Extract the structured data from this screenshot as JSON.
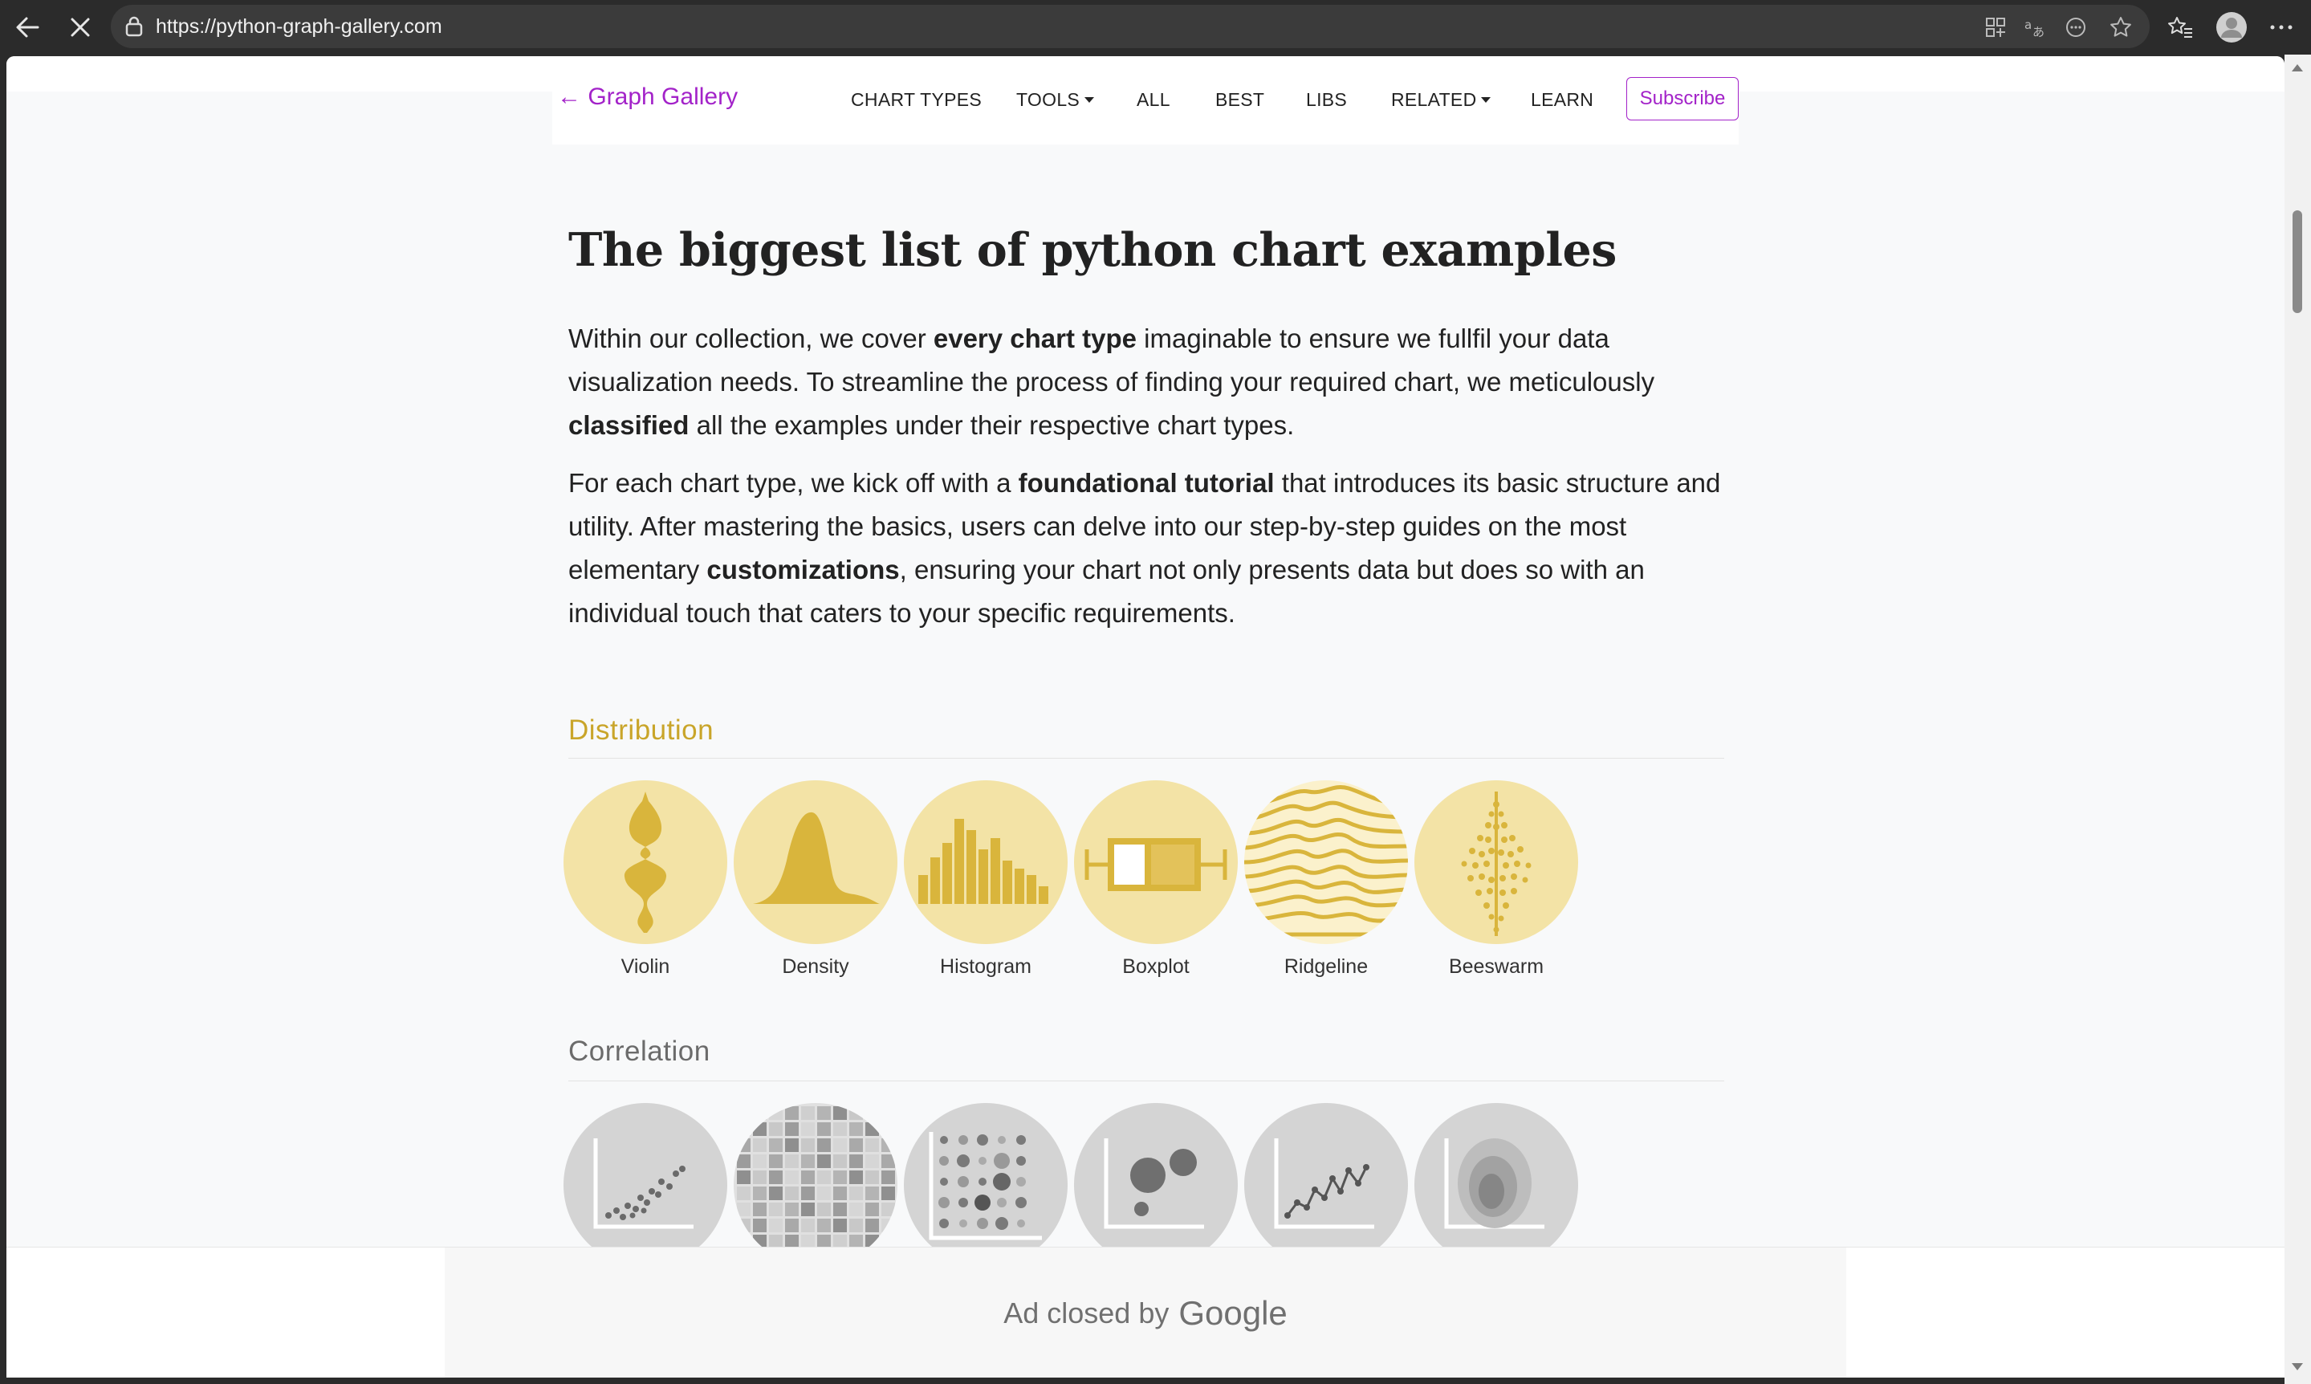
{
  "browser": {
    "url": "https://python-graph-gallery.com",
    "icons": [
      "back-arrow-icon",
      "stop-loading-icon",
      "lock-icon",
      "apps-icon",
      "translate-icon",
      "reading-view-icon",
      "favorite-star-icon",
      "favorites-list-icon",
      "profile-avatar-icon",
      "more-menu-icon"
    ]
  },
  "navbar": {
    "brand": "← Graph Gallery",
    "links": [
      "CHART TYPES",
      "TOOLS",
      "ALL",
      "BEST",
      "LIBS",
      "RELATED",
      "LEARN"
    ],
    "subscribe": "Subscribe",
    "accent_color": "#a323c9"
  },
  "main": {
    "title": "The biggest list of python chart examples",
    "intro": {
      "p1_a": "Within our collection, we cover ",
      "p1_b": "every chart type",
      "p1_c": " imaginable to ensure we fullfil your data visualization needs. To streamline the process of finding your required chart, we meticulously ",
      "p1_d": "classified",
      "p1_e": " all the examples under their respective chart types.",
      "p2_a": "For each chart type, we kick off with a ",
      "p2_b": "foundational tutorial",
      "p2_c": " that introduces its basic structure and utility. After mastering the basics, users can delve into our step-by-step guides on the most elementary ",
      "p2_d": "customizations",
      "p2_e": ", ensuring your chart not only presents data but does so with an individual touch that caters to your specific requirements."
    },
    "sections": [
      {
        "heading": "Distribution",
        "color": "#c9a52a",
        "items": [
          "Violin",
          "Density",
          "Histogram",
          "Boxplot",
          "Ridgeline",
          "Beeswarm"
        ]
      },
      {
        "heading": "Correlation",
        "color": "#6b6b6b",
        "items": []
      }
    ]
  },
  "ad": {
    "text": "Ad closed by",
    "brand": "Google"
  }
}
